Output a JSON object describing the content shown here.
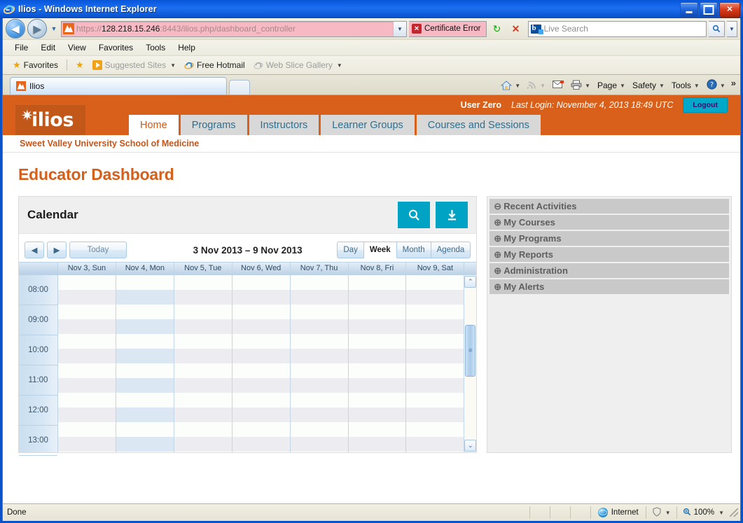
{
  "window": {
    "title": "Ilios - Windows Internet Explorer",
    "minimize_label": "Minimize",
    "maximize_label": "Maximize",
    "close_label": "Close"
  },
  "browser": {
    "back_label": "◀",
    "forward_label": "▶",
    "history_caret": "▼",
    "address": {
      "scheme": "https://",
      "host": "128.218.15.246",
      "rest": ":8443/ilios.php/dashboard_controller",
      "dropdown_caret": "▼"
    },
    "certificate_error": "Certificate Error",
    "refresh_label": "↻",
    "stop_label": "✕",
    "search": {
      "placeholder": "Live Search",
      "go_label": "🔍",
      "dropdown_caret": "▼"
    },
    "menu": [
      "File",
      "Edit",
      "View",
      "Favorites",
      "Tools",
      "Help"
    ],
    "favorites_bar": {
      "favorites_label": "Favorites",
      "items": [
        {
          "label": "Suggested Sites",
          "caret": "▼",
          "dim": true
        },
        {
          "label": "Free Hotmail",
          "caret": "",
          "dim": false
        },
        {
          "label": "Web Slice Gallery",
          "caret": "▼",
          "dim": true
        }
      ]
    },
    "tab": {
      "label": "Ilios"
    },
    "command_bar": {
      "home_caret": "▼",
      "feeds_caret": "▼",
      "mail_caret": "",
      "print_caret": "▼",
      "page_label": "Page",
      "safety_label": "Safety",
      "tools_label": "Tools",
      "help_label": "?",
      "overflow": "»"
    }
  },
  "ilios": {
    "user_name": "User Zero",
    "last_login": "Last Login: November 4, 2013 18:49 UTC",
    "logout_label": "Logout",
    "logo_text": "ilios",
    "nav_tabs": [
      {
        "label": "Home",
        "active": true
      },
      {
        "label": "Programs",
        "active": false
      },
      {
        "label": "Instructors",
        "active": false
      },
      {
        "label": "Learner Groups",
        "active": false
      },
      {
        "label": "Courses and Sessions",
        "active": false
      }
    ],
    "school": "Sweet Valley University School of Medicine",
    "page_title": "Educator Dashboard"
  },
  "calendar": {
    "panel_title": "Calendar",
    "search_icon": "search-icon",
    "download_icon": "download-icon",
    "prev_label": "◀",
    "next_label": "▶",
    "today_label": "Today",
    "range_title": "3 Nov 2013 – 9 Nov 2013",
    "views": [
      {
        "label": "Day",
        "active": false
      },
      {
        "label": "Week",
        "active": true
      },
      {
        "label": "Month",
        "active": false
      },
      {
        "label": "Agenda",
        "active": false
      }
    ],
    "day_headers": [
      {
        "label": "Nov 3, Sun",
        "today": false
      },
      {
        "label": "Nov 4, Mon",
        "today": true
      },
      {
        "label": "Nov 5, Tue",
        "today": false
      },
      {
        "label": "Nov 6, Wed",
        "today": false
      },
      {
        "label": "Nov 7, Thu",
        "today": false
      },
      {
        "label": "Nov 8, Fri",
        "today": false
      },
      {
        "label": "Nov 9, Sat",
        "today": false
      }
    ],
    "time_slots": [
      "08:00",
      "09:00",
      "10:00",
      "11:00",
      "12:00",
      "13:00"
    ],
    "events": [],
    "scroll_up": "⌃",
    "scroll_down": "⌄"
  },
  "sidebar": {
    "items": [
      {
        "label": "Recent Activities",
        "icon": "minus-circle-icon",
        "glyph": "⊖",
        "expanded": true
      },
      {
        "label": "My Courses",
        "icon": "plus-circle-icon",
        "glyph": "⊕",
        "expanded": false
      },
      {
        "label": "My Programs",
        "icon": "plus-circle-icon",
        "glyph": "⊕",
        "expanded": false
      },
      {
        "label": "My Reports",
        "icon": "plus-circle-icon",
        "glyph": "⊕",
        "expanded": false
      },
      {
        "label": "Administration",
        "icon": "plus-circle-icon",
        "glyph": "⊕",
        "expanded": false
      },
      {
        "label": "My Alerts",
        "icon": "plus-circle-icon",
        "glyph": "⊕",
        "expanded": false
      }
    ]
  },
  "statusbar": {
    "status": "Done",
    "zone": "Internet",
    "protected_caret": "▼",
    "zoom": "100%",
    "zoom_caret": "▼"
  },
  "colors": {
    "brand_orange": "#d9601a",
    "brand_orange_dark": "#c2571a",
    "accent_teal": "#00a3c4",
    "title_blue": "#1d6ff0",
    "address_pink": "#f7b9c4"
  }
}
